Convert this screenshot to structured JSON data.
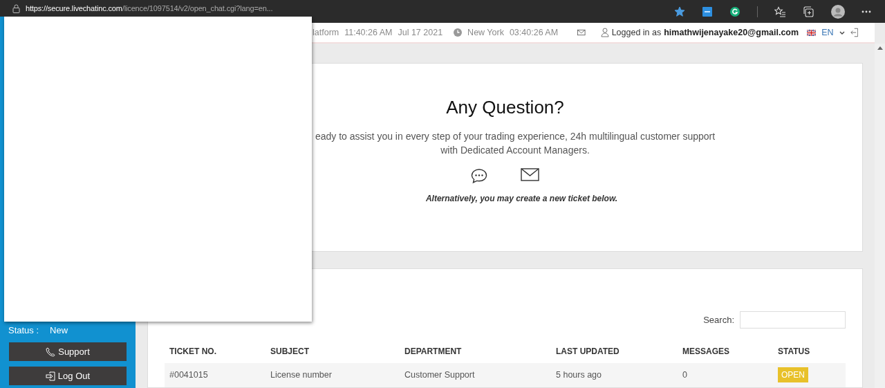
{
  "browser": {
    "url": {
      "origin": "https://secure.livechatinc.com",
      "path": "/licence/1097514/v2/open_chat.cgi?lang=en..."
    },
    "favorite_starred": true
  },
  "header": {
    "platform_label": "latform",
    "platform_time": "11:40:26 AM",
    "platform_date": "Jul 17 2021",
    "city": "New York",
    "city_time": "03:40:26 AM",
    "login_prefix": "Logged in as",
    "user_email": "himathwijenayake20@gmail.com",
    "language": "EN"
  },
  "sidebar": {
    "status_label": "Status :",
    "status_value": "New",
    "buttons": [
      {
        "label": "Support",
        "kind": "phone"
      },
      {
        "label": "Log Out",
        "kind": "logout"
      }
    ]
  },
  "contact_card": {
    "title": "Any Question?",
    "text": "eady to assist you in every step of your trading experience, 24h multilingual customer support with Dedicated Account Managers.",
    "note": "Alternatively, you may create a new ticket below."
  },
  "tickets": {
    "search_label": "Search:",
    "columns": [
      "TICKET NO.",
      "SUBJECT",
      "DEPARTMENT",
      "LAST UPDATED",
      "MESSAGES",
      "STATUS"
    ],
    "rows": [
      {
        "ticket_no": "#0041015",
        "subject": "License number",
        "department": "Customer Support",
        "last_updated": "5 hours ago",
        "messages": "0",
        "status": {
          "label": "OPEN",
          "kind": "open"
        }
      }
    ]
  }
}
